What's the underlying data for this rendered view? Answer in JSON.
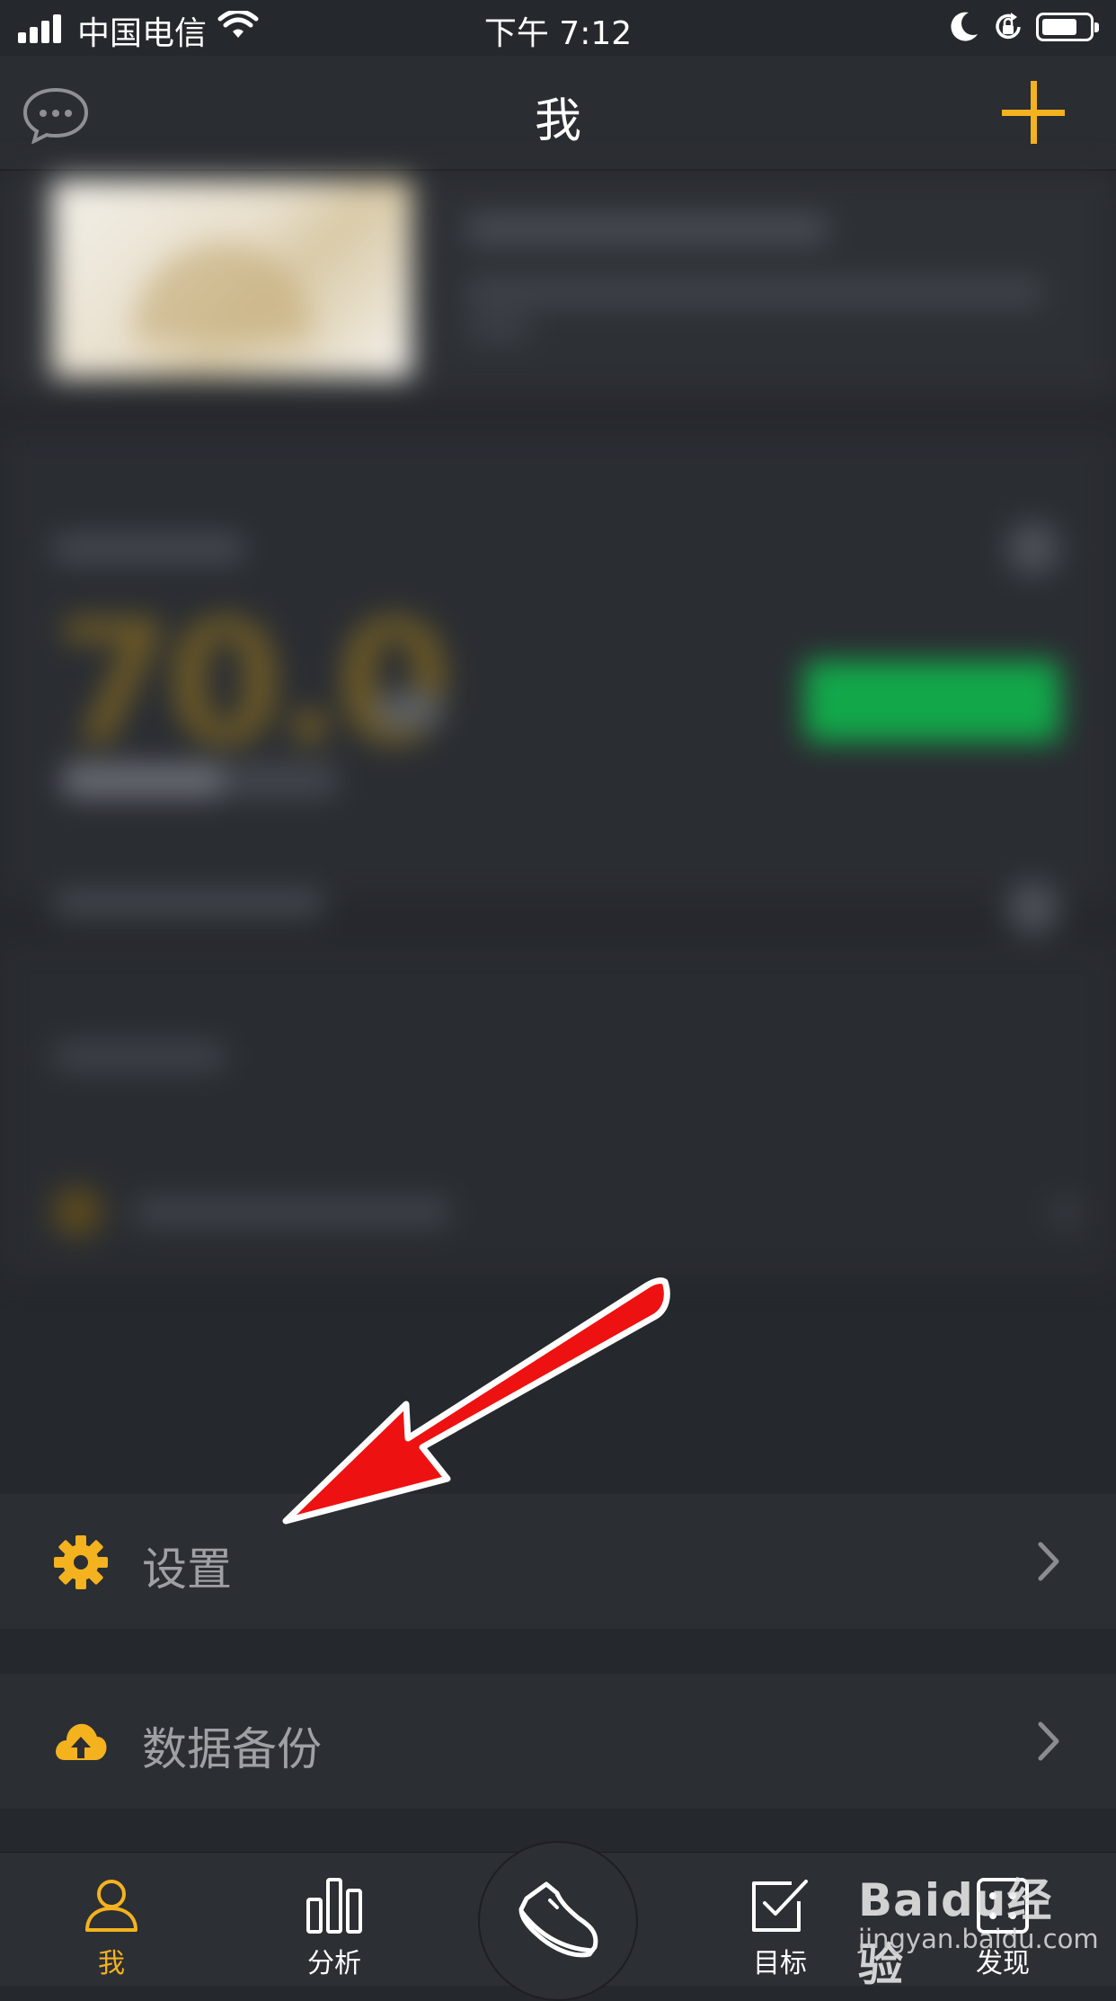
{
  "status_bar": {
    "carrier": "中国电信",
    "time": "下午 7:12"
  },
  "nav": {
    "title": "我"
  },
  "blurred": {
    "weight_value": "70.0",
    "weight_unit": "kg"
  },
  "rows": [
    {
      "label": "设置",
      "icon": "gear-icon"
    },
    {
      "label": "数据备份",
      "icon": "cloud-upload-icon"
    }
  ],
  "tabs": [
    {
      "label": "我",
      "icon": "person-icon",
      "active": true
    },
    {
      "label": "分析",
      "icon": "bar-chart-icon",
      "active": false
    },
    {
      "label": "",
      "icon": "shoe-icon",
      "active": false
    },
    {
      "label": "目标",
      "icon": "checkbox-icon",
      "active": false
    },
    {
      "label": "发现",
      "icon": "discover-icon",
      "active": false
    }
  ],
  "watermark": {
    "brand": "Baidu经验",
    "url": "jingyan.baidu.com"
  },
  "colors": {
    "accent": "#f4b21e",
    "background": "#25282c",
    "row": "#2b2e33",
    "arrow": "#ee1111"
  }
}
